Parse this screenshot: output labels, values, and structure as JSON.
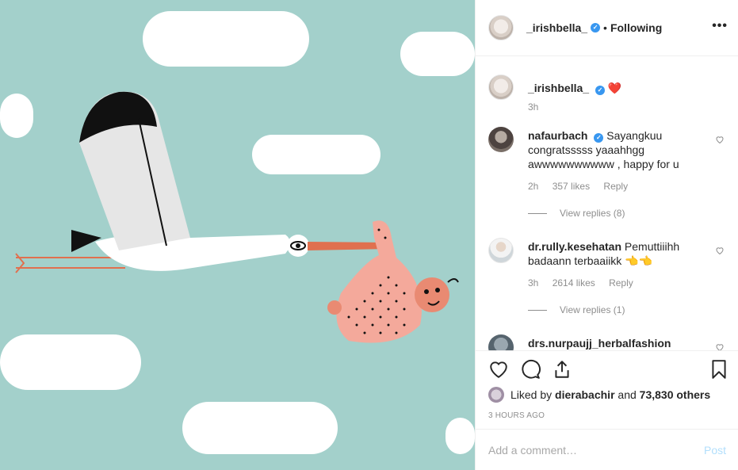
{
  "post": {
    "author": "_irishbella_",
    "follow_dot": "•",
    "follow_status": "Following",
    "more_icon": "more-options-icon",
    "caption_time": "3h",
    "caption_heart": "❤️",
    "colors": {
      "background": "#a3d0cb",
      "verified": "#3897f0",
      "heart": "#ed4956",
      "link": "#3897f0"
    }
  },
  "comments": [
    {
      "user": "nafaurbach",
      "verified": true,
      "text": "Sayangkuu congratsssss yaaahhgg awwwwwwwwww , happy for u",
      "time": "2h",
      "likes": "357 likes",
      "reply": "Reply",
      "view_replies": "View replies (8)"
    },
    {
      "user": "dr.rully.kesehatan",
      "verified": false,
      "text": "Pemuttiiihh badaann terbaaiikk 👈👈",
      "time": "3h",
      "likes": "2614 likes",
      "reply": "Reply",
      "view_replies": "View replies (1)"
    },
    {
      "user": "drs.nurpaujj_herbalfashion",
      "verified": false,
      "text": ""
    }
  ],
  "likes": {
    "prefix": "Liked by",
    "user": "dierabachir",
    "joiner": "and",
    "count": "73,830 others"
  },
  "timestamp": "3 HOURS AGO",
  "add_comment": {
    "placeholder": "Add a comment…",
    "post_label": "Post"
  }
}
